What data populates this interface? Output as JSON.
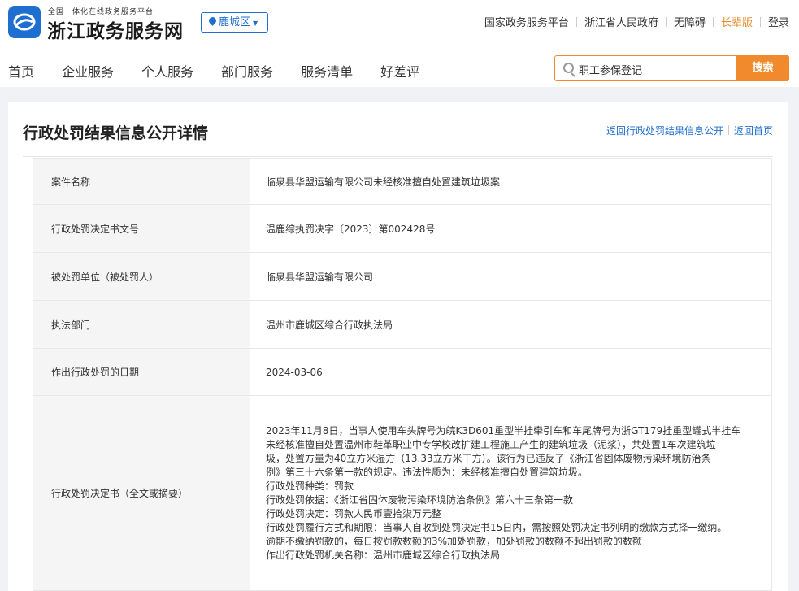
{
  "header": {
    "logo_subtitle": "全国一体化在线政务服务平台",
    "logo_title": "浙江政务服务网",
    "region": "鹿城区",
    "top_links": [
      {
        "label": "国家政务服务平台"
      },
      {
        "label": "浙江省人民政府"
      },
      {
        "label": "无障碍"
      },
      {
        "label": "长辈版"
      },
      {
        "label": "登录"
      }
    ],
    "nav": [
      "首页",
      "企业服务",
      "个人服务",
      "部门服务",
      "服务清单",
      "好差评"
    ],
    "search": {
      "value": "职工参保登记",
      "button": "搜索"
    }
  },
  "colors": {
    "brand_blue": "#1f6fd1",
    "accent_orange": "#f08a2c"
  },
  "detail": {
    "title": "行政处罚结果信息公开详情",
    "back_link": "返回行政处罚结果信息公开",
    "home_link": "返回首页",
    "rows": [
      {
        "label": "案件名称",
        "value": "临泉县华盟运输有限公司未经核准擅自处置建筑垃圾案"
      },
      {
        "label": "行政处罚决定书文号",
        "value": "温鹿综执罚决字〔2023〕第002428号"
      },
      {
        "label": "被处罚单位（被处罚人）",
        "value": "临泉县华盟运输有限公司"
      },
      {
        "label": "执法部门",
        "value": "温州市鹿城区综合行政执法局"
      },
      {
        "label": "作出行政处罚的日期",
        "value": "2024-03-06"
      }
    ],
    "decision": {
      "label": "行政处罚决定书（全文或摘要）",
      "lines": [
        "2023年11月8日，当事人使用车头牌号为皖K3D601重型半挂牵引车和车尾牌号为浙GT179挂重型罐式半挂车",
        "未经核准擅自处置温州市鞋革职业中专学校改扩建工程施工产生的建筑垃圾（泥浆），共处置1车次建筑垃",
        "圾，处置方量为40立方米湿方（13.33立方米干方）。该行为已违反了《浙江省固体废物污染环境防治条",
        "例》第三十六条第一款的规定。违法性质为：未经核准擅自处置建筑垃圾。",
        "行政处罚种类：罚款",
        "行政处罚依据：《浙江省固体废物污染环境防治条例》第六十三条第一款",
        "行政处罚决定：罚款人民币壹拾柒万元整",
        "行政处罚履行方式和期限：当事人自收到处罚决定书15日内，需按照处罚决定书列明的缴款方式择一缴纳。",
        "逾期不缴纳罚款的，每日按罚款数额的3%加处罚款，加处罚款的数额不超出罚款的数额",
        "作出行政处罚机关名称：温州市鹿城区综合行政执法局"
      ]
    }
  }
}
